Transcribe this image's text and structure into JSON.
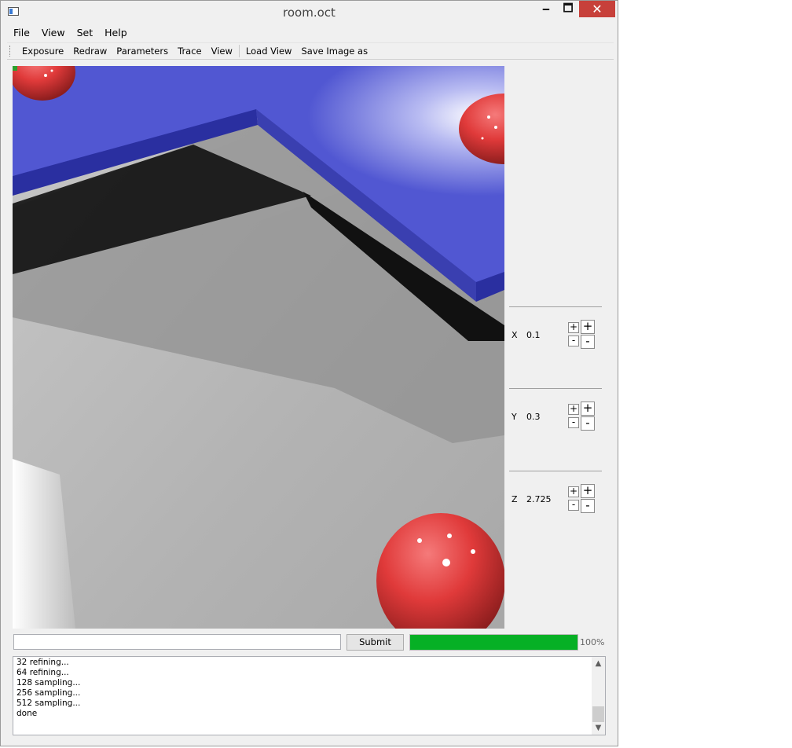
{
  "window": {
    "title": "room.oct",
    "minimize": "🗕",
    "maximize": "🗖",
    "close": "✕"
  },
  "menu": [
    "File",
    "View",
    "Set",
    "Help"
  ],
  "toolbar": [
    "Exposure",
    "Redraw",
    "Parameters",
    "Trace",
    "View",
    "Load View",
    "Save Image as"
  ],
  "coords": [
    {
      "label": "X",
      "value": "0.1"
    },
    {
      "label": "Y",
      "value": "0.3"
    },
    {
      "label": "Z",
      "value": "2.725"
    }
  ],
  "stepper": {
    "plus": "+",
    "minus": "-"
  },
  "command": {
    "value": "",
    "submit_label": "Submit"
  },
  "progress": {
    "percent": 100,
    "text": "100%"
  },
  "log": [
    "32 refining...",
    "64 refining...",
    "128 sampling...",
    "256 sampling...",
    "512 sampling...",
    "done"
  ],
  "colors": {
    "progress": "#06b025",
    "close_button": "#c7403a",
    "shelf": "#4f55d4",
    "sphere": "#e23a3a"
  },
  "icons": {
    "app": "app-window-icon",
    "scroll_up": "▲",
    "scroll_down": "▼"
  }
}
